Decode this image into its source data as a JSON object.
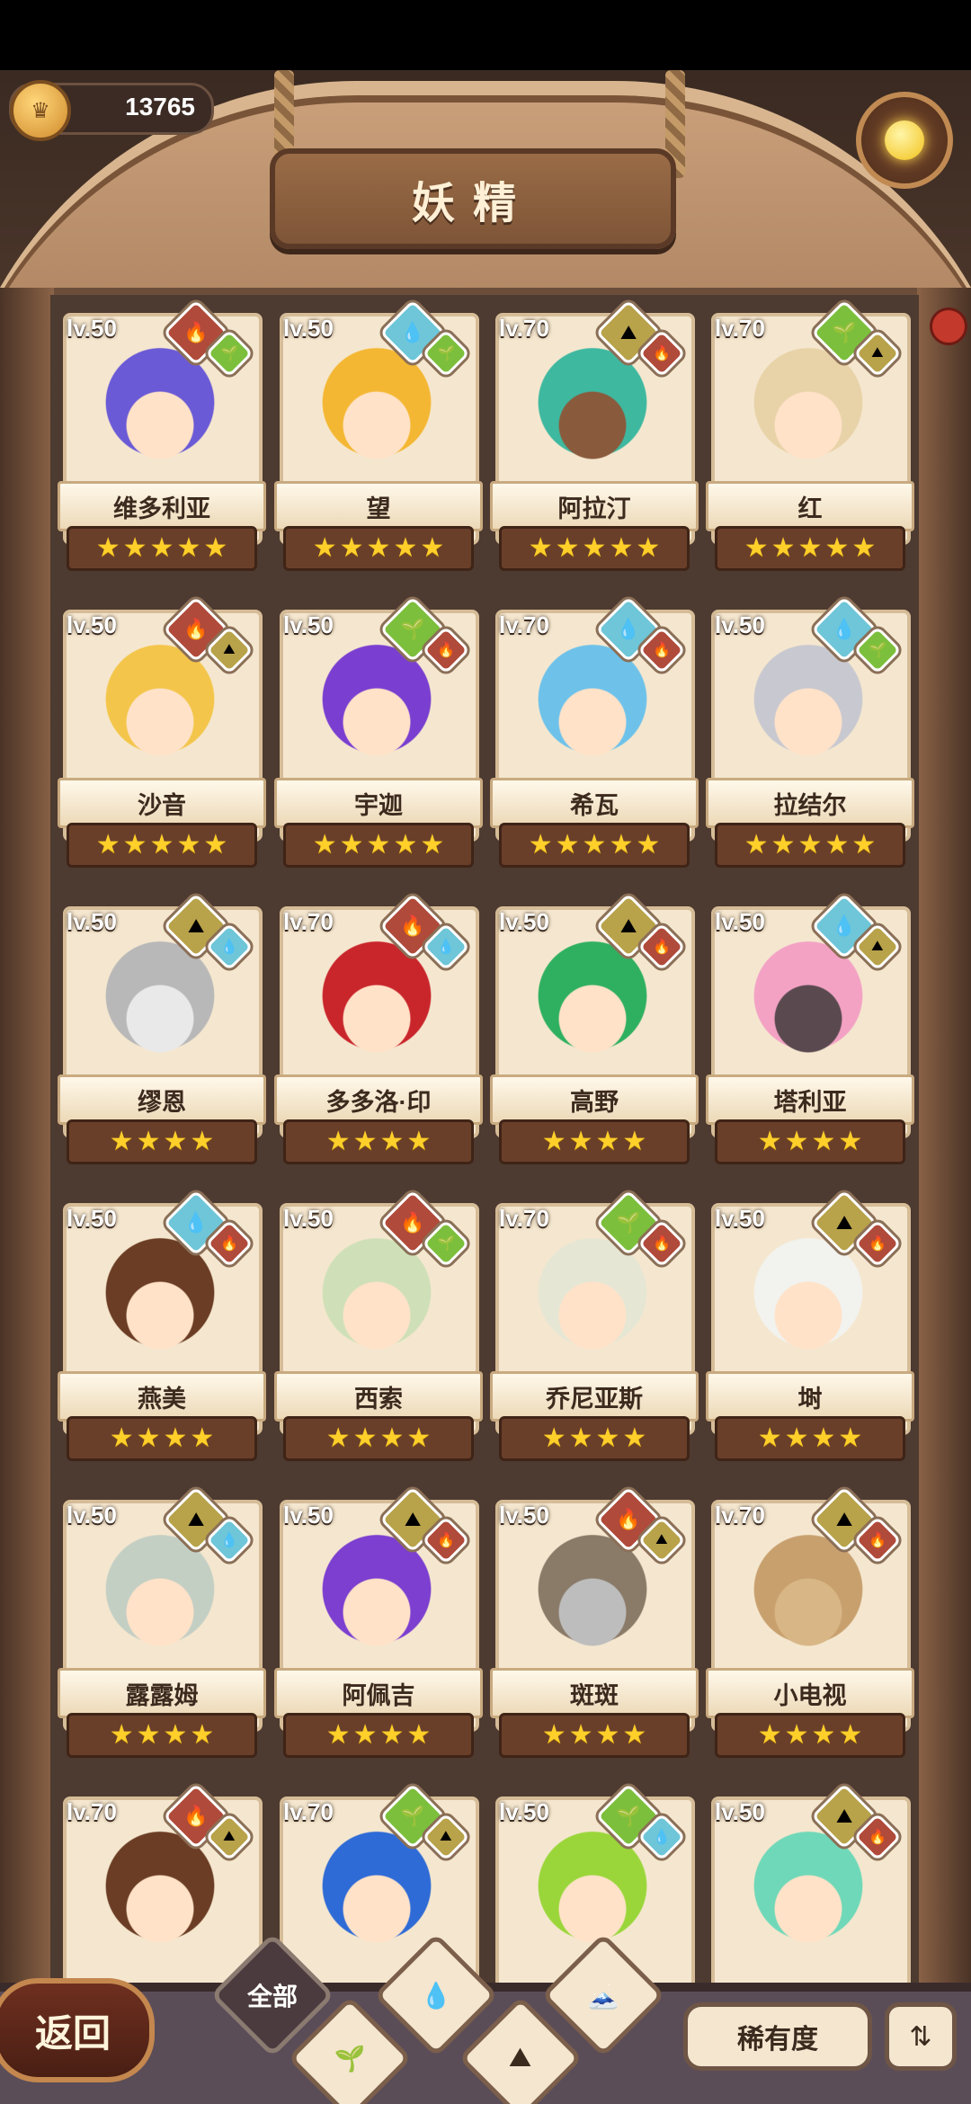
{
  "header": {
    "title": "妖精",
    "currency_value": "13765",
    "currency_icon": "crown-coin-icon",
    "hint_icon": "lightbulb-sprout-icon"
  },
  "fairies": [
    {
      "name": "维多利亚",
      "level": "lv.50",
      "stars": 5,
      "elements": [
        "fire",
        "grass"
      ],
      "hair": "#6b5ad6",
      "skin": "#ffe2c8"
    },
    {
      "name": "望",
      "level": "lv.50",
      "stars": 5,
      "elements": [
        "water",
        "grass"
      ],
      "hair": "#f4b733",
      "skin": "#ffe2c8"
    },
    {
      "name": "阿拉汀",
      "level": "lv.70",
      "stars": 5,
      "elements": [
        "earth",
        "fire"
      ],
      "hair": "#3fb8a0",
      "skin": "#8a5a3c"
    },
    {
      "name": "红",
      "level": "lv.70",
      "stars": 5,
      "elements": [
        "grass",
        "earth"
      ],
      "hair": "#e8d2a8",
      "skin": "#ffe2c8"
    },
    {
      "name": "沙音",
      "level": "lv.50",
      "stars": 5,
      "elements": [
        "fire",
        "earth"
      ],
      "hair": "#f3c54a",
      "skin": "#ffe2c8"
    },
    {
      "name": "宇迦",
      "level": "lv.50",
      "stars": 5,
      "elements": [
        "grass",
        "fire"
      ],
      "hair": "#7a3fd0",
      "skin": "#ffe2c8"
    },
    {
      "name": "希瓦",
      "level": "lv.70",
      "stars": 5,
      "elements": [
        "water",
        "fire"
      ],
      "hair": "#6ec2ea",
      "skin": "#ffe2c8"
    },
    {
      "name": "拉结尔",
      "level": "lv.50",
      "stars": 5,
      "elements": [
        "water",
        "grass"
      ],
      "hair": "#c8c8d0",
      "skin": "#ffe2c8"
    },
    {
      "name": "缪恩",
      "level": "lv.50",
      "stars": 4,
      "elements": [
        "earth",
        "water"
      ],
      "hair": "#b8b8b8",
      "skin": "#e9e9e9"
    },
    {
      "name": "多多洛·印",
      "level": "lv.70",
      "stars": 4,
      "elements": [
        "fire",
        "water"
      ],
      "hair": "#c9262c",
      "skin": "#ffe2c8"
    },
    {
      "name": "高野",
      "level": "lv.50",
      "stars": 4,
      "elements": [
        "earth",
        "fire"
      ],
      "hair": "#2fb060",
      "skin": "#ffe2c8"
    },
    {
      "name": "塔利亚",
      "level": "lv.50",
      "stars": 4,
      "elements": [
        "water",
        "earth"
      ],
      "hair": "#f3a2c4",
      "skin": "#5a4a50"
    },
    {
      "name": "燕美",
      "level": "lv.50",
      "stars": 4,
      "elements": [
        "water",
        "fire"
      ],
      "hair": "#6b3d24",
      "skin": "#ffe2c8"
    },
    {
      "name": "西索",
      "level": "lv.50",
      "stars": 4,
      "elements": [
        "fire",
        "grass"
      ],
      "hair": "#cfe0b8",
      "skin": "#ffe2c8"
    },
    {
      "name": "乔尼亚斯",
      "level": "lv.70",
      "stars": 4,
      "elements": [
        "grass",
        "fire"
      ],
      "hair": "#e6e6d4",
      "skin": "#ffe2c8"
    },
    {
      "name": "埘",
      "level": "lv.50",
      "stars": 4,
      "elements": [
        "earth",
        "fire"
      ],
      "hair": "#f2f2ee",
      "skin": "#ffe2c8"
    },
    {
      "name": "露露姆",
      "level": "lv.50",
      "stars": 4,
      "elements": [
        "earth",
        "water"
      ],
      "hair": "#c4cfc4",
      "skin": "#ffe2c8"
    },
    {
      "name": "阿佩吉",
      "level": "lv.50",
      "stars": 4,
      "elements": [
        "earth",
        "fire"
      ],
      "hair": "#7c3fd0",
      "skin": "#ffe2c8"
    },
    {
      "name": "斑斑",
      "level": "lv.50",
      "stars": 4,
      "elements": [
        "fire",
        "earth"
      ],
      "hair": "#8a7a68",
      "skin": "#bdbdbd"
    },
    {
      "name": "小电视",
      "level": "lv.70",
      "stars": 4,
      "elements": [
        "earth",
        "fire"
      ],
      "hair": "#c8a06e",
      "skin": "#d8b686"
    },
    {
      "name": "",
      "level": "lv.70",
      "stars": 0,
      "elements": [
        "fire",
        "earth"
      ],
      "hair": "#6b3d24",
      "skin": "#ffe2c8"
    },
    {
      "name": "",
      "level": "lv.70",
      "stars": 0,
      "elements": [
        "grass",
        "earth"
      ],
      "hair": "#2f6bd6",
      "skin": "#ffe2c8"
    },
    {
      "name": "",
      "level": "lv.50",
      "stars": 0,
      "elements": [
        "grass",
        "water"
      ],
      "hair": "#9ad63a",
      "skin": "#ffe2c8"
    },
    {
      "name": "",
      "level": "lv.50",
      "stars": 0,
      "elements": [
        "earth",
        "fire"
      ],
      "hair": "#6fd8b8",
      "skin": "#ffe2c8"
    }
  ],
  "element_colors": {
    "fire": "#b04a3a",
    "water": "#6ec6d8",
    "earth": "#b8a24a",
    "grass": "#7cbf3c"
  },
  "bottom": {
    "back_label": "返回",
    "filter_all_label": "全部",
    "filter_icons": [
      "sprout-filter-icon",
      "water-filter-icon",
      "mountain-filter-icon",
      "mountain-fire-filter-icon"
    ],
    "rarity_label": "稀有度",
    "sort_icon": "sort-order-icon"
  }
}
